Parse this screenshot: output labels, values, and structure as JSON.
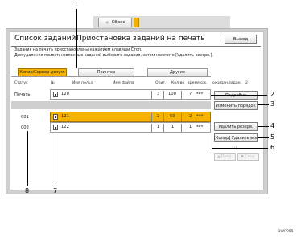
{
  "reset_button": {
    "label": "Сброс",
    "icon": "reset-icon"
  },
  "header": {
    "title_left": "Список заданий",
    "title_right": "Приостановка заданий на печать",
    "exit_label": "Выход"
  },
  "info_lines": [
    "Задания на печать приостановлены нажатием клавиши Стоп.",
    "Для удаления приостановленных заданий выберите задания, затем нажмите [Удалить резерв.]."
  ],
  "tabs": [
    {
      "label": "Копир/Сервер докум."
    },
    {
      "label": "Принтер"
    },
    {
      "label": "Другие"
    }
  ],
  "columns": {
    "status": "Статус",
    "no": "№",
    "user": "Имя польз.",
    "file": "Имя файла",
    "orig": "Ориг.",
    "qty": "Кол-во",
    "time": "время ож.",
    "wait": "ожидан.задан.",
    "wait_count": "2"
  },
  "rows": [
    {
      "status": "Печать",
      "no": "120",
      "orig": "3",
      "qty": "100",
      "time": "7",
      "unit": "мин"
    },
    {
      "status": "001",
      "no": "121",
      "orig": "2",
      "qty": "50",
      "time": "2",
      "unit": "мин"
    },
    {
      "status": "002",
      "no": "122",
      "orig": "1",
      "qty": "1",
      "time": "1",
      "unit": "мин"
    }
  ],
  "side_buttons": {
    "details": "Подробно",
    "change_order": "Изменить порядок",
    "delete_reserve": "Удалить резерв.",
    "delete_all": "[Копир] Удалить все"
  },
  "pager": {
    "page": "1/1",
    "prev": "▲ Пред.",
    "next": "▼ След."
  },
  "callouts": [
    "1",
    "2",
    "3",
    "4",
    "5",
    "6",
    "7",
    "8"
  ],
  "footer_code": "DWP055"
}
